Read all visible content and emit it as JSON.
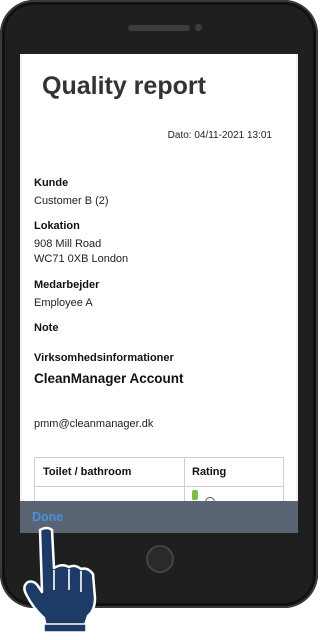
{
  "report": {
    "title": "Quality report",
    "date": "Dato: 04/11-2021 13:01",
    "customer_label": "Kunde",
    "customer_value": "Customer B (2)",
    "location_label": "Lokation",
    "location_line1": "908 Mill Road",
    "location_line2": "WC71 0XB London",
    "employee_label": "Medarbejder",
    "employee_value": "Employee A",
    "note_label": "Note",
    "company_info_label": "Virksomhedsinformationer",
    "company_name": "CleanManager Account",
    "company_email": "pmm@cleanmanager.dk",
    "table": {
      "headers": [
        "Toilet / bathroom",
        "Rating"
      ]
    }
  },
  "toolbar": {
    "done_label": "Done"
  },
  "icons": {
    "rating_icon": "thumbs-up-icon",
    "pointer": "hand-pointer-icon"
  },
  "colors": {
    "done": "#4a8fe0",
    "toolbar": "#5b6472",
    "hand": "#1e3a66"
  }
}
